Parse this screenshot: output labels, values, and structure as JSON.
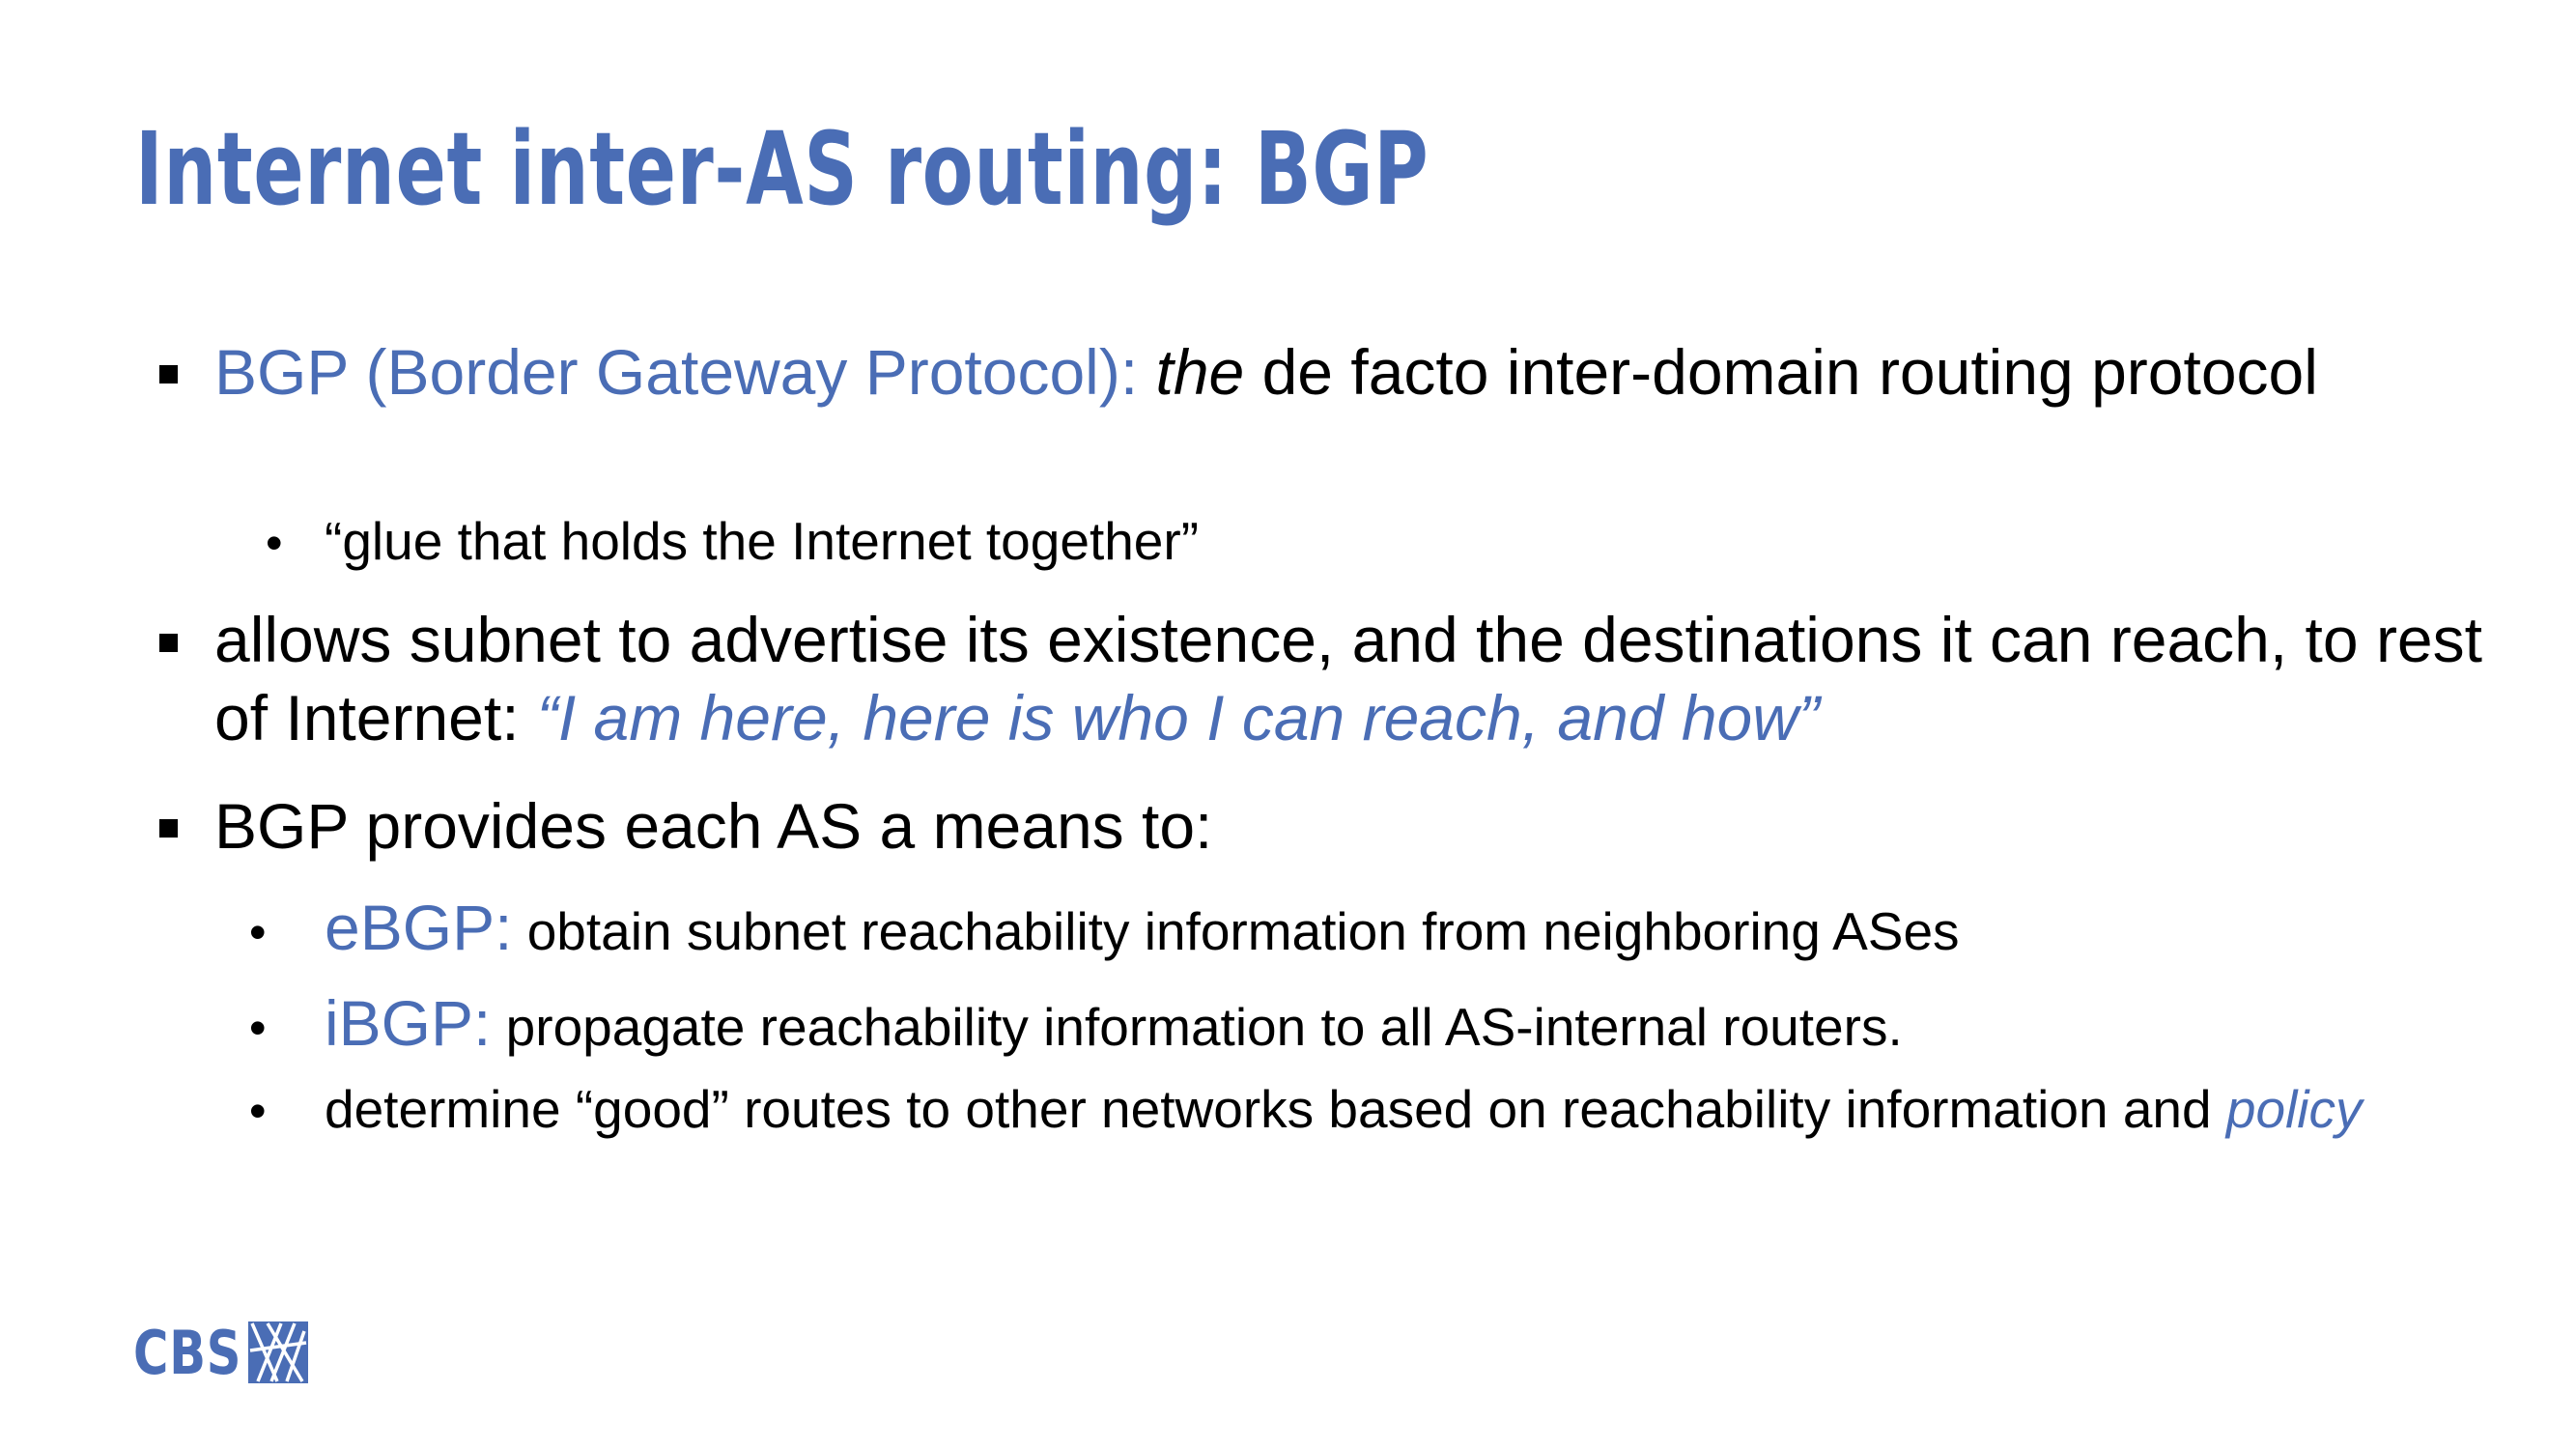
{
  "slide": {
    "title": "Internet inter-AS routing: BGP",
    "b1_lead": "BGP (Border Gateway Protocol):",
    "b1_the": "the",
    "b1_rest": " de facto inter-domain routing protocol",
    "b1_sub": "“glue that holds the Internet together”",
    "b2_text": "allows subnet to advertise its existence, and the destinations it can reach, to rest of Internet: ",
    "b2_quote": "“I am here, here is who I can reach, and how”",
    "b3_text": "BGP provides each AS a means to:",
    "sub1_lead": "eBGP:",
    "sub1_text": " obtain subnet reachability information from neighboring ASes",
    "sub2_lead": "iBGP:",
    "sub2_text": " propagate reachability information to all AS-internal routers.",
    "sub3_text": "determine “good” routes to other networks based on reachability information and ",
    "sub3_policy": "policy"
  },
  "logo": {
    "text": "CBS"
  },
  "colors": {
    "accent": "#4a6db5",
    "text": "#000000",
    "background": "#ffffff"
  }
}
